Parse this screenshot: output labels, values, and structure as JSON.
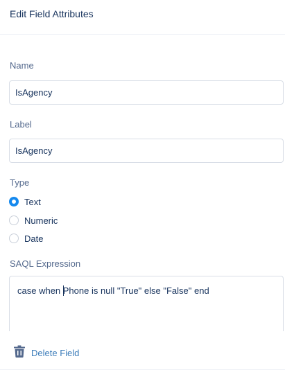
{
  "header": {
    "title": "Edit Field Attributes"
  },
  "name_field": {
    "label": "Name",
    "value": "IsAgency"
  },
  "label_field": {
    "label": "Label",
    "value": "IsAgency"
  },
  "type_field": {
    "label": "Type",
    "options": [
      {
        "label": "Text",
        "checked": true
      },
      {
        "label": "Numeric",
        "checked": false
      },
      {
        "label": "Date",
        "checked": false
      }
    ]
  },
  "saql": {
    "label": "SAQL Expression",
    "value_before_caret": "case when ",
    "value_after_caret": "Phone is null \"True\" else \"False\" end"
  },
  "footer": {
    "delete_label": "Delete Field",
    "delete_icon": "trash-icon"
  },
  "colors": {
    "accent": "#1589ee",
    "link": "#3a7bb9",
    "label": "#54698d",
    "text": "#16325c"
  }
}
